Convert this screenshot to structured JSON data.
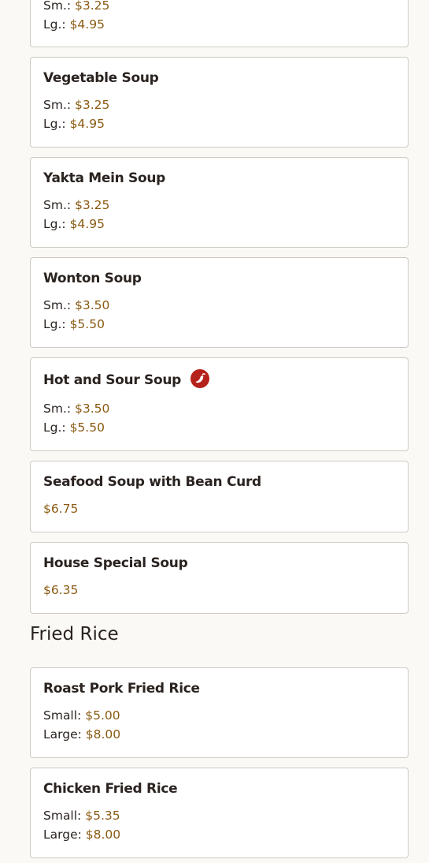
{
  "soups": {
    "partial_item": {
      "small": {
        "label": "Sm.:",
        "price": "$3.25"
      },
      "large": {
        "label": "Lg.:",
        "price": "$4.95"
      }
    },
    "items": [
      {
        "name": "Vegetable Soup",
        "small": {
          "label": "Sm.:",
          "price": "$3.25"
        },
        "large": {
          "label": "Lg.:",
          "price": "$4.95"
        }
      },
      {
        "name": "Yakta Mein Soup",
        "small": {
          "label": "Sm.:",
          "price": "$3.25"
        },
        "large": {
          "label": "Lg.:",
          "price": "$4.95"
        }
      },
      {
        "name": "Wonton Soup",
        "small": {
          "label": "Sm.:",
          "price": "$3.50"
        },
        "large": {
          "label": "Lg.:",
          "price": "$5.50"
        }
      },
      {
        "name": "Hot and Sour Soup",
        "spicy_icon": "spicy-pepper-icon",
        "small": {
          "label": "Sm.:",
          "price": "$3.50"
        },
        "large": {
          "label": "Lg.:",
          "price": "$5.50"
        }
      },
      {
        "name": "Seafood Soup with Bean Curd",
        "price": "$6.75"
      },
      {
        "name": "House Special Soup",
        "price": "$6.35"
      }
    ]
  },
  "fried_rice": {
    "section_title": "Fried Rice",
    "items": [
      {
        "name": "Roast Pork Fried Rice",
        "small": {
          "label": "Small:",
          "price": "$5.00"
        },
        "large": {
          "label": "Large:",
          "price": "$8.00"
        }
      },
      {
        "name": "Chicken Fried Rice",
        "small": {
          "label": "Small:",
          "price": "$5.35"
        },
        "large": {
          "label": "Large:",
          "price": "$8.00"
        }
      }
    ]
  },
  "colors": {
    "price": "#8a5a12",
    "text": "#2a2320",
    "card_border": "#cfcac4",
    "spicy_icon": "#b5221b",
    "background": "#faf9f6"
  }
}
